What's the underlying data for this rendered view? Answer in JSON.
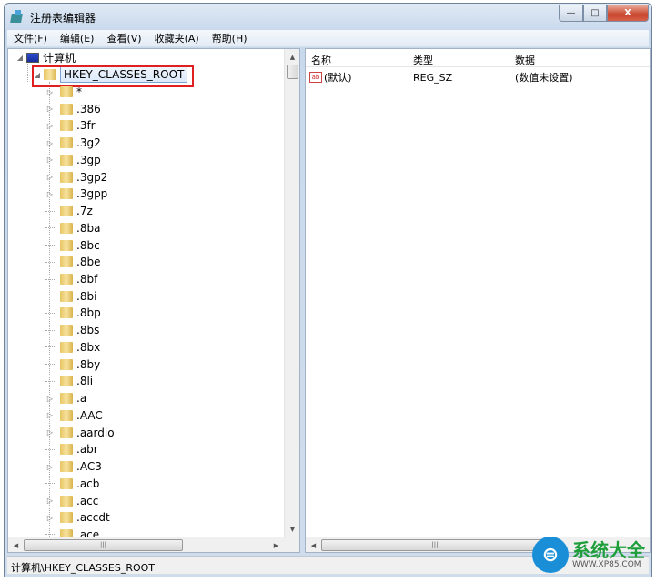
{
  "window": {
    "title": "注册表编辑器",
    "controls": {
      "minimize": "—",
      "maximize": "□",
      "close": "X"
    }
  },
  "menu": [
    "文件(F)",
    "编辑(E)",
    "查看(V)",
    "收藏夹(A)",
    "帮助(H)"
  ],
  "tree": {
    "root": "计算机",
    "selected": "HKEY_CLASSES_ROOT",
    "items": [
      {
        "label": "*",
        "expandable": true
      },
      {
        "label": ".386",
        "expandable": true
      },
      {
        "label": ".3fr",
        "expandable": true
      },
      {
        "label": ".3g2",
        "expandable": true
      },
      {
        "label": ".3gp",
        "expandable": true
      },
      {
        "label": ".3gp2",
        "expandable": true
      },
      {
        "label": ".3gpp",
        "expandable": true
      },
      {
        "label": ".7z",
        "expandable": false
      },
      {
        "label": ".8ba",
        "expandable": false
      },
      {
        "label": ".8bc",
        "expandable": false
      },
      {
        "label": ".8be",
        "expandable": false
      },
      {
        "label": ".8bf",
        "expandable": false
      },
      {
        "label": ".8bi",
        "expandable": false
      },
      {
        "label": ".8bp",
        "expandable": false
      },
      {
        "label": ".8bs",
        "expandable": false
      },
      {
        "label": ".8bx",
        "expandable": false
      },
      {
        "label": ".8by",
        "expandable": false
      },
      {
        "label": ".8li",
        "expandable": false
      },
      {
        "label": ".a",
        "expandable": true
      },
      {
        "label": ".AAC",
        "expandable": true
      },
      {
        "label": ".aardio",
        "expandable": true
      },
      {
        "label": ".abr",
        "expandable": false
      },
      {
        "label": ".AC3",
        "expandable": true
      },
      {
        "label": ".acb",
        "expandable": false
      },
      {
        "label": ".acc",
        "expandable": true
      },
      {
        "label": ".accdt",
        "expandable": true
      },
      {
        "label": ".ace",
        "expandable": false
      }
    ]
  },
  "list": {
    "columns": [
      "名称",
      "类型",
      "数据"
    ],
    "rows": [
      {
        "name": "(默认)",
        "type": "REG_SZ",
        "data": "(数值未设置)",
        "icon": "string-value-icon"
      }
    ]
  },
  "status": "计算机\\HKEY_CLASSES_ROOT",
  "watermark": {
    "brand": "系统大全",
    "url": "WWW.XP85.COM"
  },
  "colors": {
    "highlight_box": "#e02020",
    "folder": "#e7c460"
  }
}
